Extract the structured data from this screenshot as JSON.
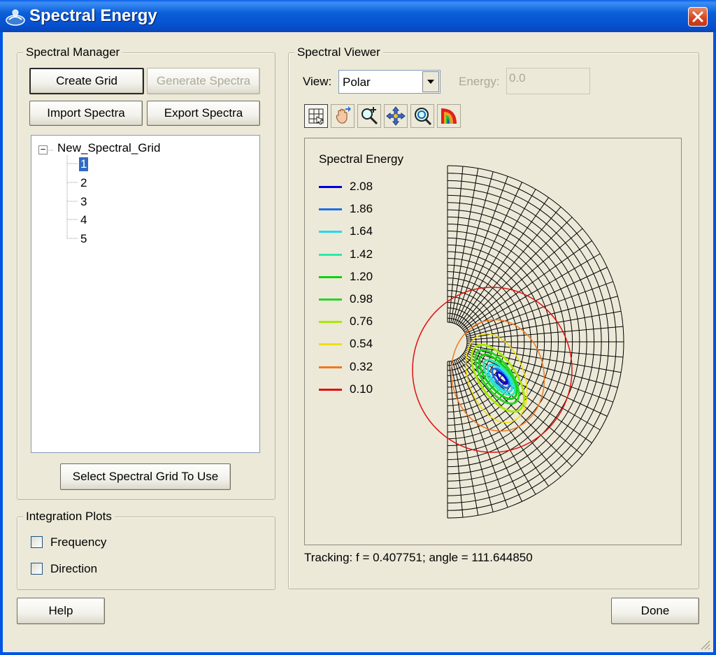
{
  "window": {
    "title": "Spectral Energy"
  },
  "spectral_manager": {
    "label": "Spectral Manager",
    "buttons": {
      "create_grid": "Create Grid",
      "generate_spectra": "Generate Spectra",
      "import_spectra": "Import Spectra",
      "export_spectra": "Export Spectra",
      "select_grid": "Select Spectral Grid To Use"
    },
    "tree": {
      "root": "New_Spectral_Grid",
      "root_toggle": "−",
      "children": [
        "1",
        "2",
        "3",
        "4",
        "5"
      ],
      "selected": "1"
    }
  },
  "integration_plots": {
    "label": "Integration Plots",
    "frequency": {
      "label": "Frequency",
      "checked": false
    },
    "direction": {
      "label": "Direction",
      "checked": false
    }
  },
  "spectral_viewer": {
    "label": "Spectral Viewer",
    "view_label": "View:",
    "view_value": "Polar",
    "energy_label": "Energy:",
    "energy_value": "0.0",
    "toolbar": [
      "grid-display-icon",
      "pan-hand-icon",
      "zoom-in-icon",
      "move-icon",
      "zoom-extents-icon",
      "contour-icon"
    ],
    "legend": {
      "title": "Spectral Energy",
      "items": [
        {
          "value": "2.08",
          "color": "#0000d8"
        },
        {
          "value": "1.86",
          "color": "#1f6fe8"
        },
        {
          "value": "1.64",
          "color": "#22d8f0"
        },
        {
          "value": "1.42",
          "color": "#2ee8a8"
        },
        {
          "value": "1.20",
          "color": "#10d010"
        },
        {
          "value": "0.98",
          "color": "#28d428"
        },
        {
          "value": "0.76",
          "color": "#a8e800"
        },
        {
          "value": "0.54",
          "color": "#f0e000"
        },
        {
          "value": "0.32",
          "color": "#f07820"
        },
        {
          "value": "0.10",
          "color": "#e01010"
        }
      ]
    },
    "tracking": "Tracking: f = 0.407751; angle = 111.644850"
  },
  "footer": {
    "help": "Help",
    "done": "Done"
  }
}
